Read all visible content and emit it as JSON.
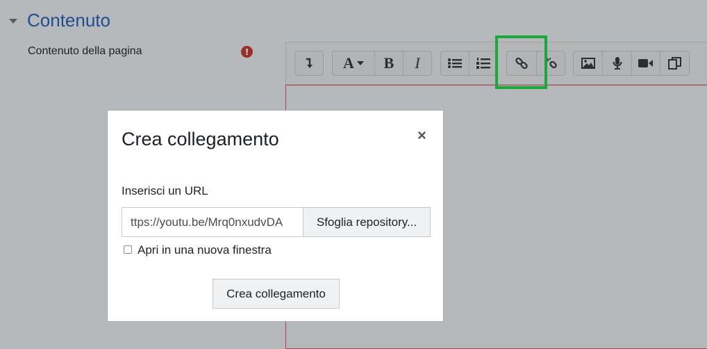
{
  "section": {
    "title": "Contenuto"
  },
  "field": {
    "label": "Contenuto della pagina",
    "required_icon": "!"
  },
  "toolbar": {
    "icons": [
      "show-more-icon",
      "font-style-icon",
      "bold-icon",
      "italic-icon",
      "unordered-list-icon",
      "ordered-list-icon",
      "link-icon",
      "unlink-icon",
      "image-icon",
      "record-audio-icon",
      "record-video-icon",
      "media-manager-icon"
    ],
    "bold_glyph": "B",
    "italic_glyph": "I",
    "font_glyph": "A"
  },
  "dialog": {
    "title": "Crea collegamento",
    "close_glyph": "×",
    "url_label": "Inserisci un URL",
    "url_value": "ttps://youtu.be/Mrq0nxudvDA",
    "browse_label": "Sfoglia repository...",
    "new_window_label": "Apri in una nuova finestra",
    "new_window_checked": false,
    "submit_label": "Crea collegamento"
  },
  "colors": {
    "highlight": "#19a83a",
    "section_title": "#1f4d8f",
    "required": "#9a2f2a"
  }
}
